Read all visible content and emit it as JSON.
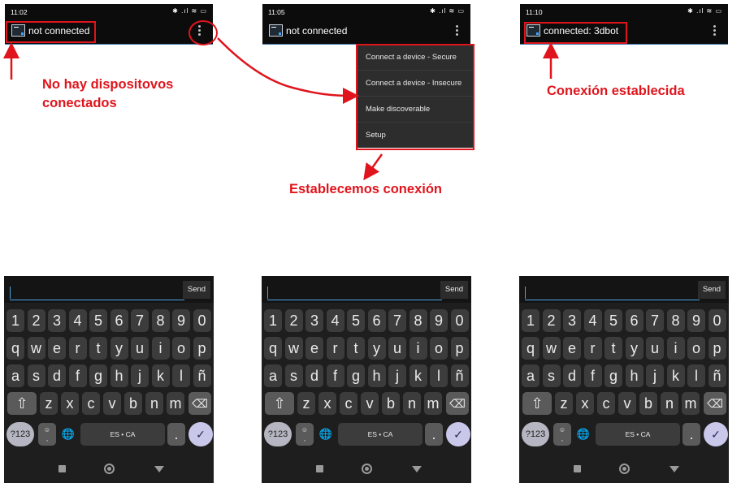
{
  "screens": [
    {
      "time": "11:02",
      "status_icons": "✱ .ıl ≋ ▭",
      "title": "not connected"
    },
    {
      "time": "11:05",
      "status_icons": "✱ .ıl ≋ ▭",
      "title": "not connected"
    },
    {
      "time": "11:10",
      "status_icons": "✱ .ıl ≋ ▭",
      "title": "connected: 3dbot"
    }
  ],
  "menu": {
    "items": [
      "Connect a device - Secure",
      "Connect a device - Insecure",
      "Make discoverable",
      "Setup"
    ]
  },
  "annotations": {
    "no_devices_line1": "No hay dispositovos",
    "no_devices_line2": "conectados",
    "establish": "Establecemos conexión",
    "established": "Conexión establecida",
    "accent_color": "#e0141c"
  },
  "keyboard": {
    "send_label": "Send",
    "row_numbers": [
      "1",
      "2",
      "3",
      "4",
      "5",
      "6",
      "7",
      "8",
      "9",
      "0"
    ],
    "row_q": [
      "q",
      "w",
      "e",
      "r",
      "t",
      "y",
      "u",
      "i",
      "o",
      "p"
    ],
    "row_a": [
      "a",
      "s",
      "d",
      "f",
      "g",
      "h",
      "j",
      "k",
      "l",
      "ñ"
    ],
    "row_z": [
      "z",
      "x",
      "c",
      "v",
      "b",
      "n",
      "m"
    ],
    "shift_icon": "⇧",
    "backspace_icon": "⌫",
    "sym_label": "?123",
    "emoji_label": "☺\n,",
    "globe_icon": "🌐",
    "space_label": "ES • CA",
    "period_label": ".",
    "enter_icon": "✓"
  }
}
